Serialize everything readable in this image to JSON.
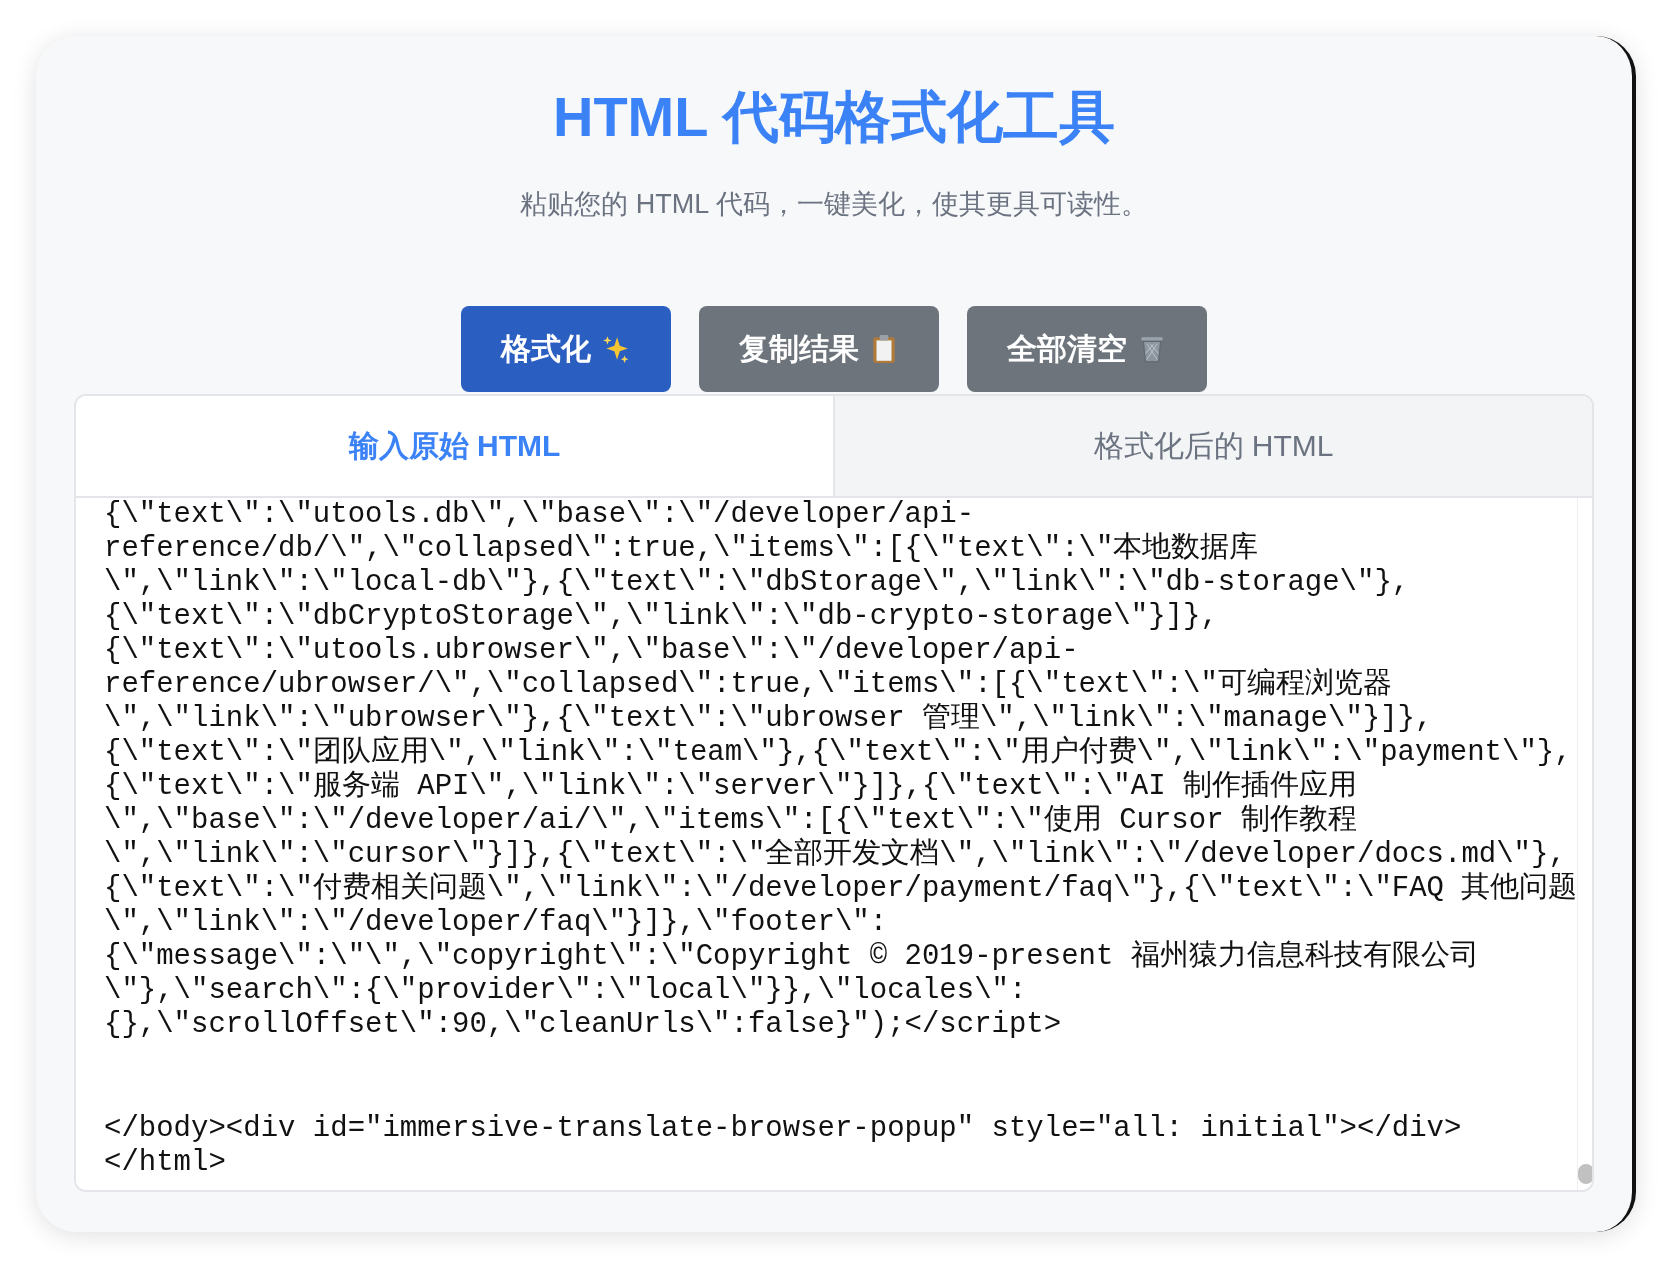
{
  "header": {
    "title": "HTML 代码格式化工具",
    "subtitle": "粘贴您的 HTML 代码，一键美化，使其更具可读性。"
  },
  "buttons": [
    {
      "label": "格式化",
      "kind": "primary"
    },
    {
      "label": "复制结果",
      "kind": "secondary"
    },
    {
      "label": "全部清空",
      "kind": "secondary"
    }
  ],
  "tabs": [
    {
      "label": "输入原始 HTML",
      "selected": true
    },
    {
      "label": "格式化后的 HTML",
      "selected": false
    }
  ],
  "editor": {
    "blocks": [
      {
        "lines": [
          {
            "text": "{\\\"text\\\":\\\"utools.db\\\",\\\"base\\\":\\\"/developer/api-"
          },
          {
            "text": "reference/db/\\\",\\\"collapsed\\\":true,\\\"items\\\":[{\\\"text\\\":\\\"本地数据库"
          },
          {
            "text": "\\\",\\\"link\\\":\\\"local-db\\\"},{\\\"text\\\":\\\"dbStorage\\\",\\\"link\\\":\\\"db-storage\\\"},"
          },
          {
            "text": "{\\\"text\\\":\\\"dbCryptoStorage\\\",\\\"link\\\":\\\"db-crypto-storage\\\"}]},"
          },
          {
            "text": "{\\\"text\\\":\\\"utools.ubrowser\\\",\\\"base\\\":\\\"/developer/api-"
          },
          {
            "text": "reference/ubrowser/\\\",\\\"collapsed\\\":true,\\\"items\\\":[{\\\"text\\\":\\\"可编程浏览器"
          },
          {
            "text": "\\\",\\\"link\\\":\\\"ubrowser\\\"},{\\\"text\\\":\\\"ubrowser 管理\\\",\\\"link\\\":\\\"manage\\\"}]},"
          },
          {
            "text": "{\\\"text\\\":\\\"团队应用\\\",\\\"link\\\":\\\"team\\\"},{\\\"text\\\":\\\"用户付费\\\",\\\"link\\\":\\\"payment\\\"},"
          },
          {
            "text": "{\\\"text\\\":\\\"服务端 API\\\",\\\"link\\\":\\\"server\\\"}]},{\\\"text\\\":\\\"AI 制作插件应用"
          },
          {
            "text": "\\\",\\\"base\\\":\\\"/developer/ai/\\\",\\\"items\\\":[{\\\"text\\\":\\\"使用 Cursor 制作教程"
          },
          {
            "text": "\\\",\\\"link\\\":\\\"cursor\\\"}]},{\\\"text\\\":\\\"全部开发文档\\\",\\\"link\\\":\\\"/developer/docs.md\\\"},"
          },
          {
            "text": "{\\\"text\\\":\\\"付费相关问题\\\",\\\"link\\\":\\\"/developer/payment/faq\\\"},{\\\"text\\\":\\\"FAQ 其他问题"
          },
          {
            "text": "\\\",\\\"link\\\":\\\"/developer/faq\\\"}]},\\\"footer\\\":"
          },
          {
            "text": "{\\\"message\\\":\\\"\\\",\\\"copyright\\\":\\\"Copyright © 2019-present 福州猿力信息科技有限公司"
          },
          {
            "text": "\\\"},\\\"search\\\":{\\\"provider\\\":\\\"local\\\"}},\\\"locales\\\":"
          },
          {
            "text": "{},\\\"scrollOffset\\\":90,\\\"cleanUrls\\\":false}\");</script>"
          }
        ]
      },
      {
        "lines": [
          {
            "text": "</body><div id=\"immersive-translate-browser-popup\" style=\"all: initial\"></div>"
          },
          {
            "text": "</html>"
          }
        ]
      }
    ]
  }
}
